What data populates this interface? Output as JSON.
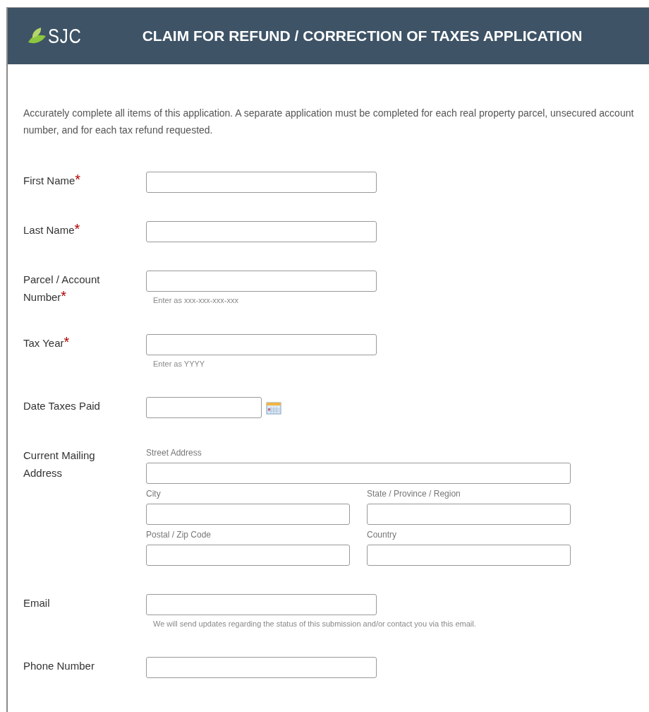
{
  "header": {
    "logo_text": "SJC",
    "title": "CLAIM FOR REFUND / CORRECTION OF TAXES APPLICATION"
  },
  "intro": "Accurately complete all items of this application. A separate application must be completed for each real property parcel, unsecured account number, and for each tax refund requested.",
  "required_mark": "*",
  "fields": [
    {
      "kind": "text",
      "label": "First Name",
      "required": true
    },
    {
      "kind": "text",
      "label": "Last Name",
      "required": true
    },
    {
      "kind": "text",
      "label": "Parcel / Account Number",
      "required": true,
      "hint": "Enter as xxx-xxx-xxx-xxx"
    },
    {
      "kind": "text",
      "label": "Tax Year",
      "required": true,
      "hint": "Enter as YYYY"
    },
    {
      "kind": "date",
      "label": "Date Taxes Paid",
      "required": false
    },
    {
      "kind": "address",
      "label": "Current Mailing Address",
      "required": false,
      "parts": [
        {
          "kind": "full",
          "label": "Street Address"
        },
        {
          "kind": "half",
          "label": "City"
        },
        {
          "kind": "half",
          "label": "State / Province / Region"
        },
        {
          "kind": "half",
          "label": "Postal / Zip Code"
        },
        {
          "kind": "half",
          "label": "Country"
        }
      ]
    },
    {
      "kind": "text",
      "label": "Email",
      "required": false,
      "hint": "We will send updates regarding the status of this submission and/or contact you via this email."
    },
    {
      "kind": "text",
      "label": "Phone Number",
      "required": false
    }
  ]
}
